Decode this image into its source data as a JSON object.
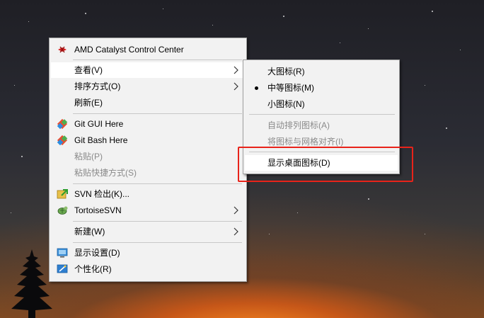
{
  "main_menu": {
    "items": [
      {
        "label": "AMD Catalyst Control Center",
        "icon": "amd-icon"
      },
      {
        "label": "查看(V)",
        "submenu": true
      },
      {
        "label": "排序方式(O)",
        "submenu": true
      },
      {
        "label": "刷新(E)"
      },
      {
        "label": "Git GUI Here",
        "icon": "git-icon"
      },
      {
        "label": "Git Bash Here",
        "icon": "git-icon"
      },
      {
        "label": "粘贴(P)",
        "disabled": true
      },
      {
        "label": "粘贴快捷方式(S)",
        "disabled": true
      },
      {
        "label": "SVN 检出(K)...",
        "icon": "svn-checkout-icon"
      },
      {
        "label": "TortoiseSVN",
        "icon": "tortoisesvn-icon",
        "submenu": true
      },
      {
        "label": "新建(W)",
        "submenu": true
      },
      {
        "label": "显示设置(D)",
        "icon": "display-icon"
      },
      {
        "label": "个性化(R)",
        "icon": "personalize-icon"
      }
    ]
  },
  "sub_menu": {
    "items": [
      {
        "label": "大图标(R)"
      },
      {
        "label": "中等图标(M)",
        "selected": true
      },
      {
        "label": "小图标(N)"
      },
      {
        "label": "自动排列图标(A)",
        "disabled": true
      },
      {
        "label": "将图标与网格对齐(I)",
        "disabled": true
      },
      {
        "label": "显示桌面图标(D)"
      }
    ]
  },
  "colors": {
    "menu_bg": "#f2f2f2",
    "highlight_bg": "#ffffff",
    "annotation_red": "#e8231a",
    "disabled_text": "#8a8a8a"
  }
}
